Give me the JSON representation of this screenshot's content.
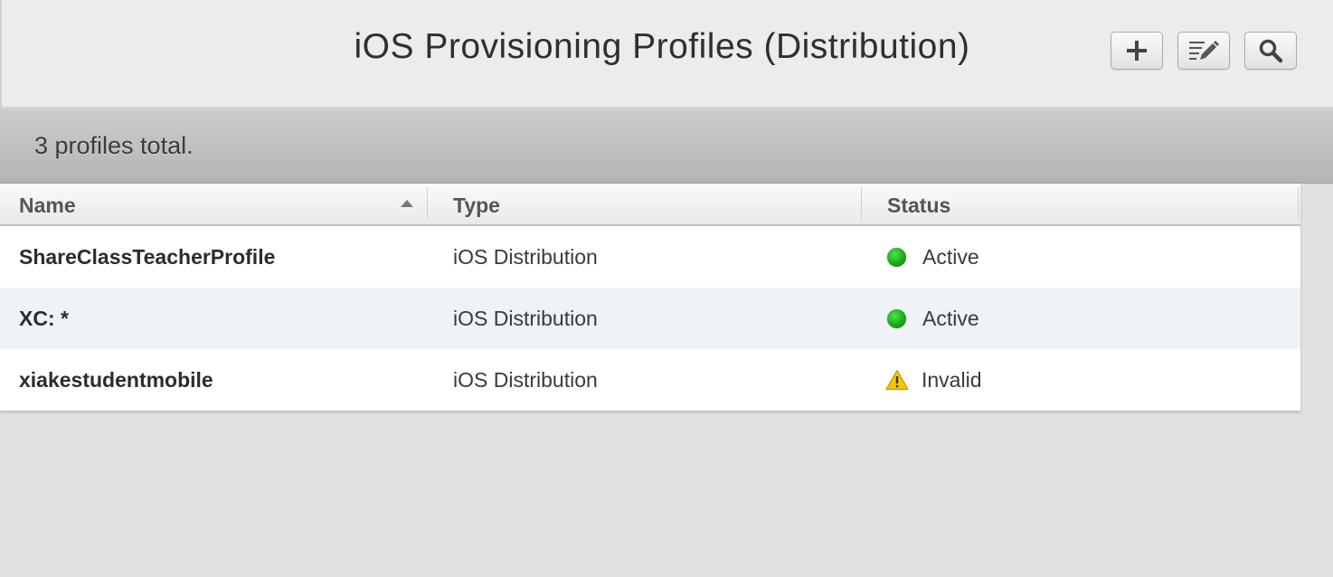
{
  "header": {
    "title": "iOS Provisioning Profiles (Distribution)",
    "buttons": [
      {
        "icon": "plus-icon"
      },
      {
        "icon": "edit-icon"
      },
      {
        "icon": "search-icon"
      }
    ]
  },
  "summary": {
    "count_text": "3 profiles total."
  },
  "table": {
    "columns": {
      "name": "Name",
      "type": "Type",
      "status": "Status"
    },
    "sort": {
      "column": "Name",
      "direction": "ascending"
    },
    "rows": [
      {
        "name": "ShareClassTeacherProfile",
        "type": "iOS Distribution",
        "status": "Active",
        "status_icon": "green-dot-icon"
      },
      {
        "name": "XC: *",
        "type": "iOS Distribution",
        "status": "Active",
        "status_icon": "green-dot-icon"
      },
      {
        "name": "xiakestudentmobile",
        "type": "iOS Distribution",
        "status": "Invalid",
        "status_icon": "warning-icon"
      }
    ]
  },
  "colors": {
    "active": "#13a513",
    "warning": "#f2c200",
    "alt_row": "#eff2f6"
  }
}
